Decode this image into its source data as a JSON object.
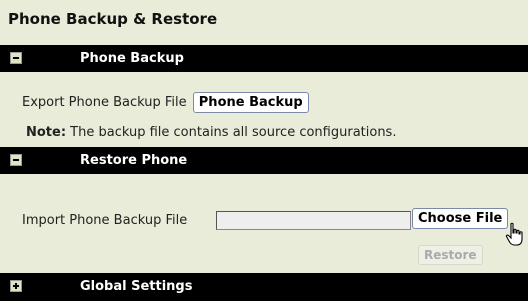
{
  "page": {
    "title": "Phone Backup & Restore"
  },
  "sections": {
    "backup": {
      "header": "Phone Backup",
      "export_label": "Export Phone Backup File",
      "button": "Phone Backup",
      "note_label": "Note:",
      "note_text": " The backup file contains all source configurations."
    },
    "restore": {
      "header": "Restore Phone",
      "import_label": "Import Phone Backup File",
      "file_value": "",
      "choose_button": "Choose File",
      "restore_button": "Restore"
    },
    "global": {
      "header": "Global Settings"
    }
  },
  "icons": {
    "collapse": "minus-toggle-icon",
    "expand": "plus-toggle-icon",
    "cursor": "hand-pointer-cursor"
  },
  "colors": {
    "background": "#e9ecd9",
    "header_bg": "#000000",
    "header_text": "#ffffff"
  }
}
